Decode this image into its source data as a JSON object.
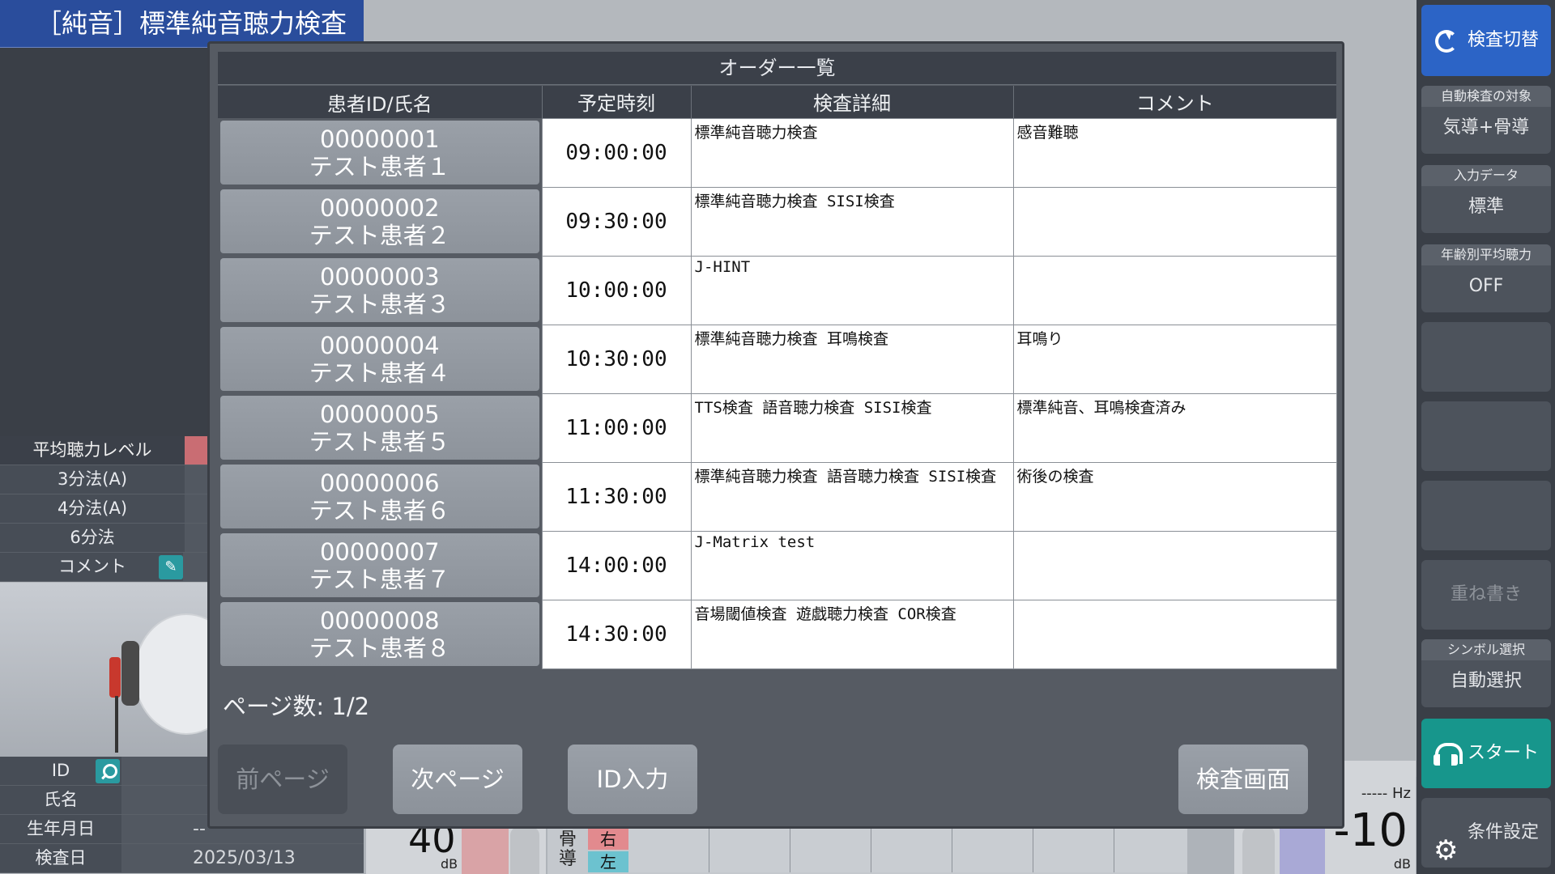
{
  "app": {
    "title": "［純音］標準純音聴力検査"
  },
  "left_panel": {
    "avg_rows": [
      "平均聴力レベル",
      "3分法(A)",
      "4分法(A)",
      "6分法",
      "コメント"
    ],
    "info": {
      "id_label": "ID",
      "name_label": "氏名",
      "dob_label": "生年月日",
      "dob_value": "--",
      "exam_date_label": "検査日",
      "exam_date_value": "2025/03/13"
    }
  },
  "background_meters": {
    "left_db_value": "40",
    "left_db_unit": "dB",
    "bone_label": "骨導",
    "right_ear": "右",
    "left_ear": "左",
    "right_hz_unit": "----- Hz",
    "right_db_value": "-10",
    "right_db_unit": "dB"
  },
  "sidebar": {
    "switch_exam": "検査切替",
    "auto_target_caption": "自動検査の対象",
    "auto_target_value": "気導+骨導",
    "input_data_caption": "入力データ",
    "input_data_value": "標準",
    "age_avg_caption": "年齢別平均聴力",
    "age_avg_value": "OFF",
    "overwrite": "重ね書き",
    "symbol_caption": "シンボル選択",
    "symbol_value": "自動選択",
    "start": "スタート",
    "settings": "条件設定"
  },
  "modal": {
    "title": "オーダー一覧",
    "columns": [
      "患者ID/氏名",
      "予定時刻",
      "検査詳細",
      "コメント"
    ],
    "orders": [
      {
        "id": "00000001",
        "name": "テスト患者１",
        "time": "09:00:00",
        "detail": "標準純音聴力検査",
        "comment": "感音難聴"
      },
      {
        "id": "00000002",
        "name": "テスト患者２",
        "time": "09:30:00",
        "detail": "標準純音聴力検査 SISI検査",
        "comment": ""
      },
      {
        "id": "00000003",
        "name": "テスト患者３",
        "time": "10:00:00",
        "detail": "J-HINT",
        "comment": ""
      },
      {
        "id": "00000004",
        "name": "テスト患者４",
        "time": "10:30:00",
        "detail": "標準純音聴力検査 耳鳴検査",
        "comment": "耳鳴り"
      },
      {
        "id": "00000005",
        "name": "テスト患者５",
        "time": "11:00:00",
        "detail": "TTS検査 語音聴力検査 SISI検査",
        "comment": "標準純音、耳鳴検査済み"
      },
      {
        "id": "00000006",
        "name": "テスト患者６",
        "time": "11:30:00",
        "detail": "標準純音聴力検査 語音聴力検査 SISI検査",
        "comment": "術後の検査"
      },
      {
        "id": "00000007",
        "name": "テスト患者７",
        "time": "14:00:00",
        "detail": "J-Matrix test",
        "comment": ""
      },
      {
        "id": "00000008",
        "name": "テスト患者８",
        "time": "14:30:00",
        "detail": "音場閾値検査 遊戯聴力検査 COR検査",
        "comment": ""
      }
    ],
    "page_count": "ページ数: 1/2",
    "buttons": {
      "prev": "前ページ",
      "next": "次ページ",
      "id_input": "ID入力",
      "exam_screen": "検査画面"
    }
  }
}
